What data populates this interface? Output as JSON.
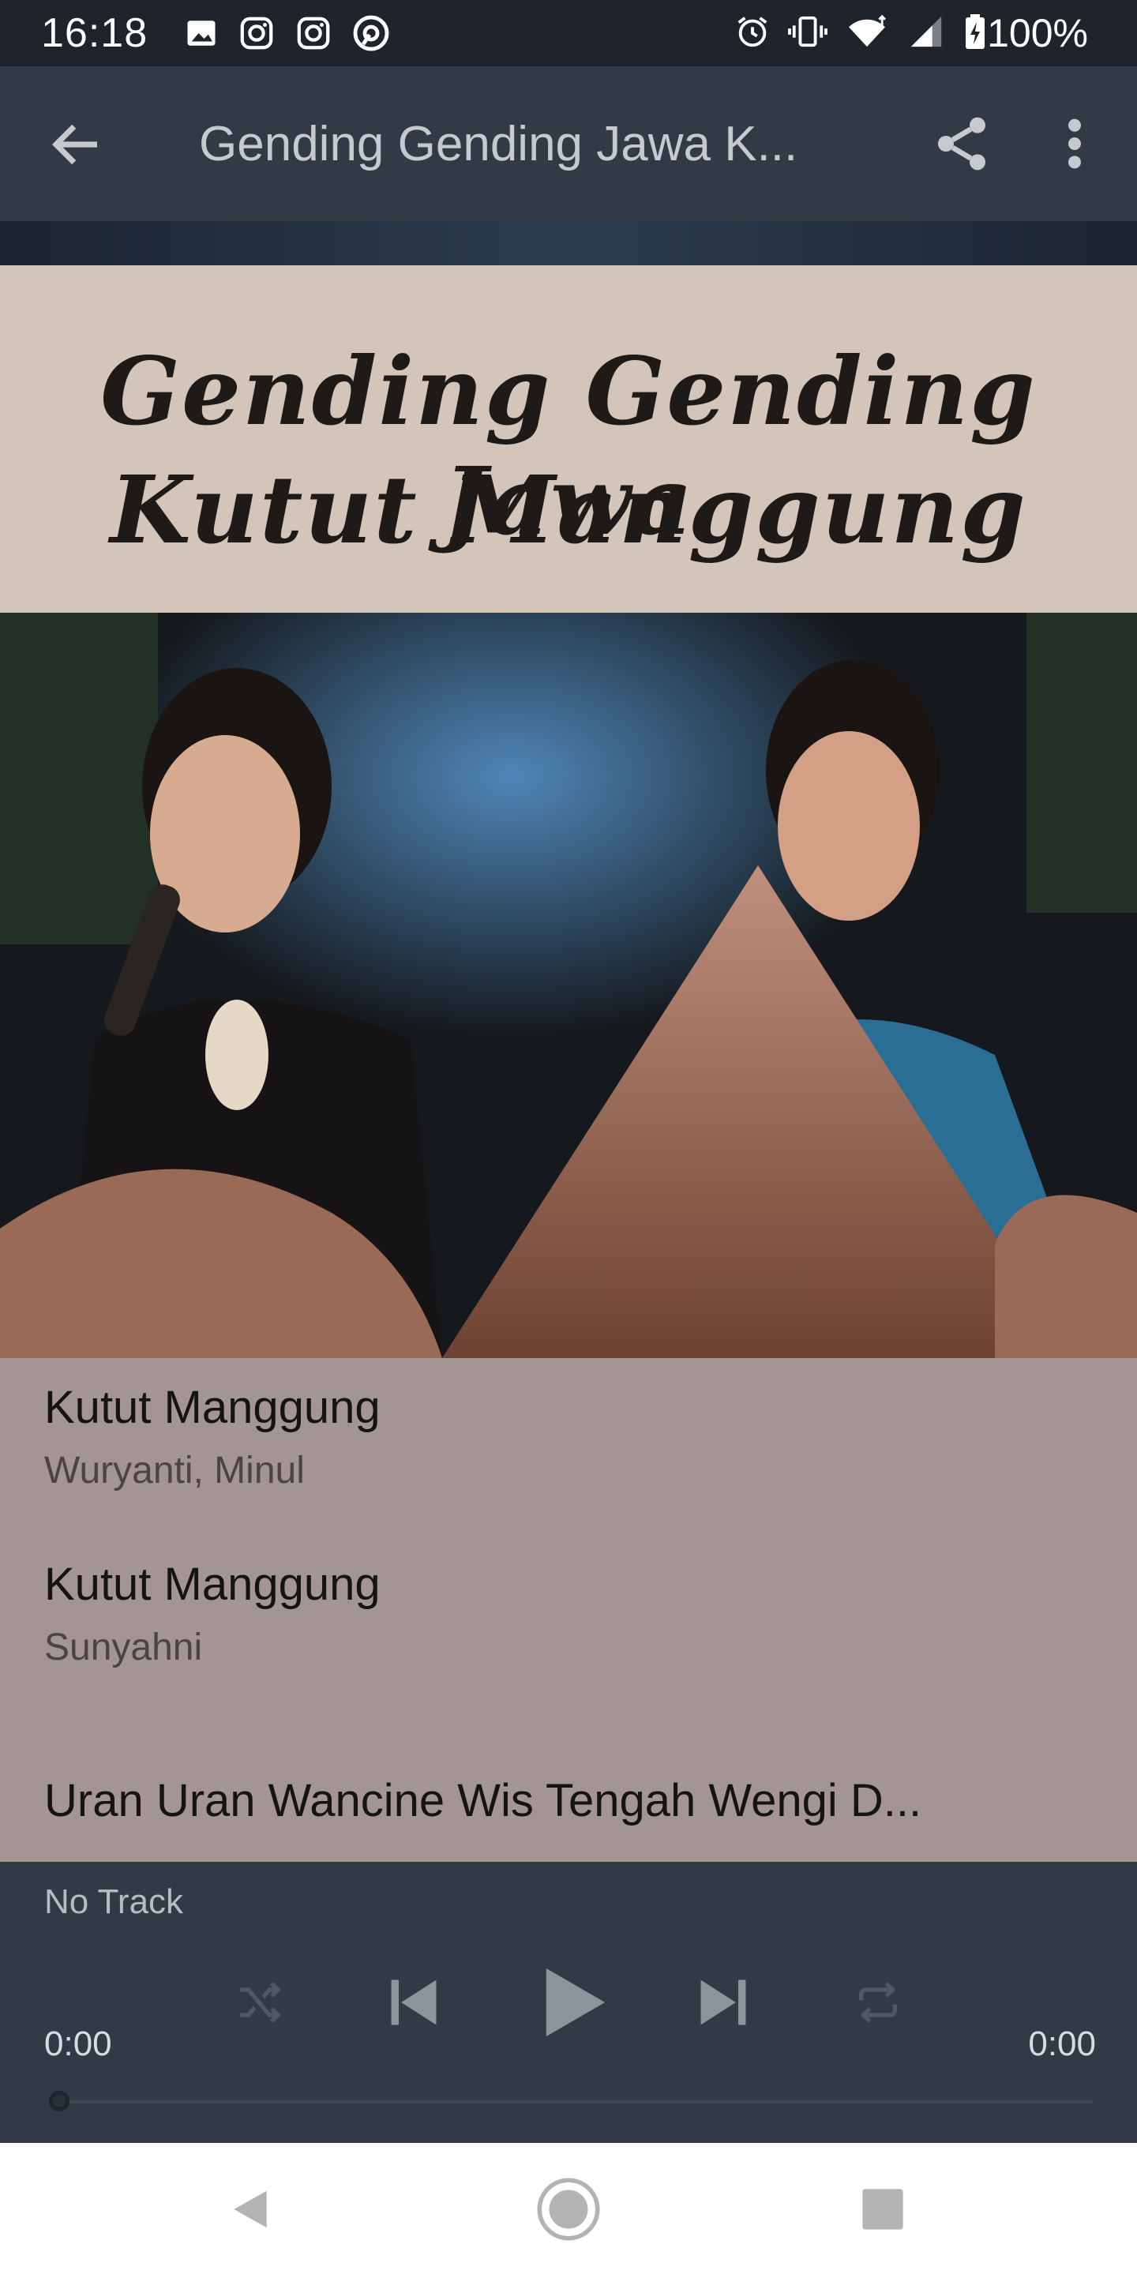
{
  "status_bar": {
    "time": "16:18",
    "battery_percent": "100%",
    "icons_left": [
      "image-icon",
      "instagram-icon",
      "instagram-icon",
      "at-sign-icon"
    ],
    "icons_right": [
      "alarm-icon",
      "vibrate-icon",
      "wifi-icon",
      "signal-icon",
      "battery-charging-icon"
    ]
  },
  "toolbar": {
    "title": "Gending Gending Jawa K...",
    "back_icon": "arrow-left-icon",
    "share_icon": "share-icon",
    "more_icon": "more-vert-icon"
  },
  "artwork": {
    "banner_line1": "Gending Gending Jawa",
    "banner_line2": "Kutut Manggung"
  },
  "tracks": [
    {
      "title": "Kutut Manggung",
      "artist": "Wuryanti, Minul"
    },
    {
      "title": "Kutut Manggung",
      "artist": "Sunyahni"
    },
    {
      "title": "Uran Uran Wancine Wis Tengah Wengi D...",
      "artist": ""
    }
  ],
  "player": {
    "now_playing": "No Track",
    "elapsed": "0:00",
    "duration": "0:00",
    "progress": 0
  },
  "colors": {
    "toolbar_bg": "#313a45",
    "tracklist_bg": "#a39593",
    "status_bg": "#1f242b",
    "nav_bg": "#ffffff"
  }
}
